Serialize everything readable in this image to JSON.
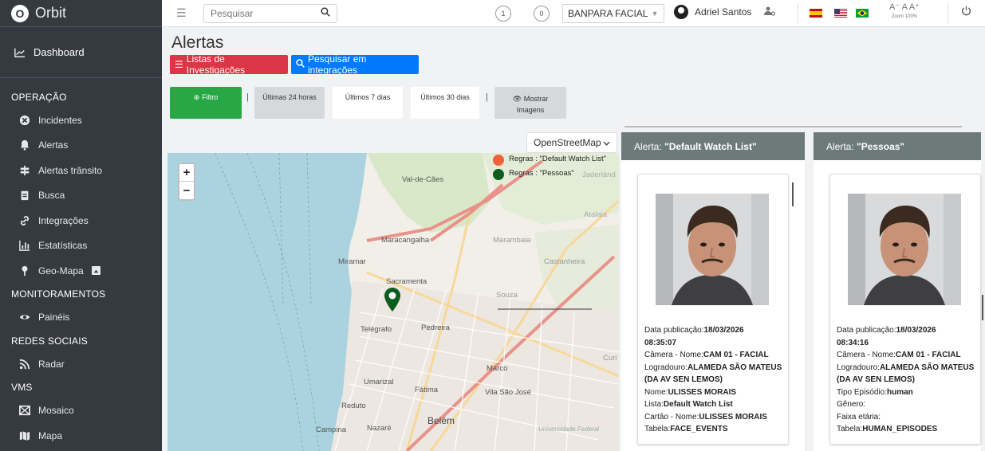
{
  "brand": {
    "logo_letter": "O",
    "name": "Orbit"
  },
  "sidebar": {
    "dashboard": "Dashboard",
    "sections": [
      {
        "header": "OPERAÇÃO",
        "items": [
          {
            "label": "Incidentes",
            "icon": "incident-icon"
          },
          {
            "label": "Alertas",
            "icon": "bell-icon"
          },
          {
            "label": "Alertas trânsito",
            "icon": "traffic-sign-icon"
          },
          {
            "label": "Busca",
            "icon": "clipboard-icon"
          },
          {
            "label": "Integrações",
            "icon": "link-icon"
          },
          {
            "label": "Estatísticas",
            "icon": "bar-chart-icon"
          },
          {
            "label": "Geo-Mapa",
            "icon": "map-pin-icon"
          }
        ]
      },
      {
        "header": "MONITORAMENTOS",
        "items": [
          {
            "label": "Painéis",
            "icon": "eye-icon"
          }
        ]
      },
      {
        "header": "REDES SOCIAIS",
        "items": [
          {
            "label": "Radar",
            "icon": "rss-icon"
          }
        ]
      },
      {
        "header": "VMS",
        "items": [
          {
            "label": "Mosaico",
            "icon": "mosaic-icon"
          },
          {
            "label": "Mapa",
            "icon": "map-icon"
          }
        ]
      }
    ]
  },
  "topbar": {
    "search_placeholder": "Pesquisar",
    "badge_1": "1",
    "badge_2": "0",
    "org": "BANPARA FACIAL",
    "user": "Adriel Santos",
    "zoom_text": "A⁻ A A⁺",
    "zoom_label": "Zoom 100%"
  },
  "page": {
    "title": "Alertas",
    "btn_lists": "Listas de Investigações",
    "btn_search": "Pesquisar em integrações",
    "filter": "Filtro",
    "last24": "Últimas 24 horas",
    "last7": "Últimos 7 dias",
    "last30": "Últimos 30 dias",
    "show_images_1": "Mostrar",
    "show_images_2": "Imagens",
    "map_layer": "OpenStreetMap"
  },
  "map": {
    "legend": [
      {
        "label": "Regras : \"Default Watch List\"",
        "color": "#f4603a"
      },
      {
        "label": "Regras : \"Pessoas\"",
        "color": "#0d5c1f"
      }
    ],
    "places": {
      "valdecaes": "Val-de-Cães",
      "jaderlandia": "Jaderlând",
      "atalaia": "Atalaia",
      "maracangalha": "Maracangalha",
      "marambaia": "Marambaia",
      "miramar": "Miramar",
      "castanheira": "Castanheira",
      "sacramenta": "Sacramenta",
      "souza": "Souza",
      "telegrafo": "Telégrafo",
      "pedreira": "Pedreira",
      "marco": "Marco",
      "curio": "Curi",
      "umarizal": "Umarizal",
      "fatima": "Fátima",
      "vilasaojose": "Vila São José",
      "reduto": "Reduto",
      "belem": "Belém",
      "campina": "Campina",
      "nazare": "Nazaré",
      "universidade": "Universidade Federal"
    }
  },
  "alerts": [
    {
      "header_label": "Alerta: ",
      "header_name": "\"Default Watch List\"",
      "fields": [
        {
          "k": "Data publicação:",
          "v": "18/03/2026"
        },
        {
          "k": "",
          "v": "08:35:07"
        },
        {
          "k": "Câmera - Nome:",
          "v": "CAM 01 - FACIAL"
        },
        {
          "k": "Logradouro:",
          "v": "ALAMEDA SÃO MATEUS"
        },
        {
          "k": "",
          "v": "(DA AV SEN LEMOS)"
        },
        {
          "k": "Nome:",
          "v": "ULISSES MORAIS"
        },
        {
          "k": "Lista:",
          "v": "Default Watch List"
        },
        {
          "k": "Cartão - Nome:",
          "v": "ULISSES MORAIS"
        },
        {
          "k": "Tabela:",
          "v": "FACE_EVENTS"
        }
      ]
    },
    {
      "header_label": "Alerta: ",
      "header_name": "\"Pessoas\"",
      "fields": [
        {
          "k": "Data publicação:",
          "v": "18/03/2026"
        },
        {
          "k": "",
          "v": "08:34:16"
        },
        {
          "k": "Câmera - Nome:",
          "v": "CAM 01 - FACIAL"
        },
        {
          "k": "Logradouro:",
          "v": "ALAMEDA SÃO MATEUS"
        },
        {
          "k": "",
          "v": "(DA AV SEN LEMOS)"
        },
        {
          "k": "Tipo Episódio:",
          "v": "human"
        },
        {
          "k": "Gênero:",
          "v": ""
        },
        {
          "k": "Faixa etária:",
          "v": ""
        },
        {
          "k": "Tabela:",
          "v": "HUMAN_EPISODES"
        }
      ]
    }
  ]
}
